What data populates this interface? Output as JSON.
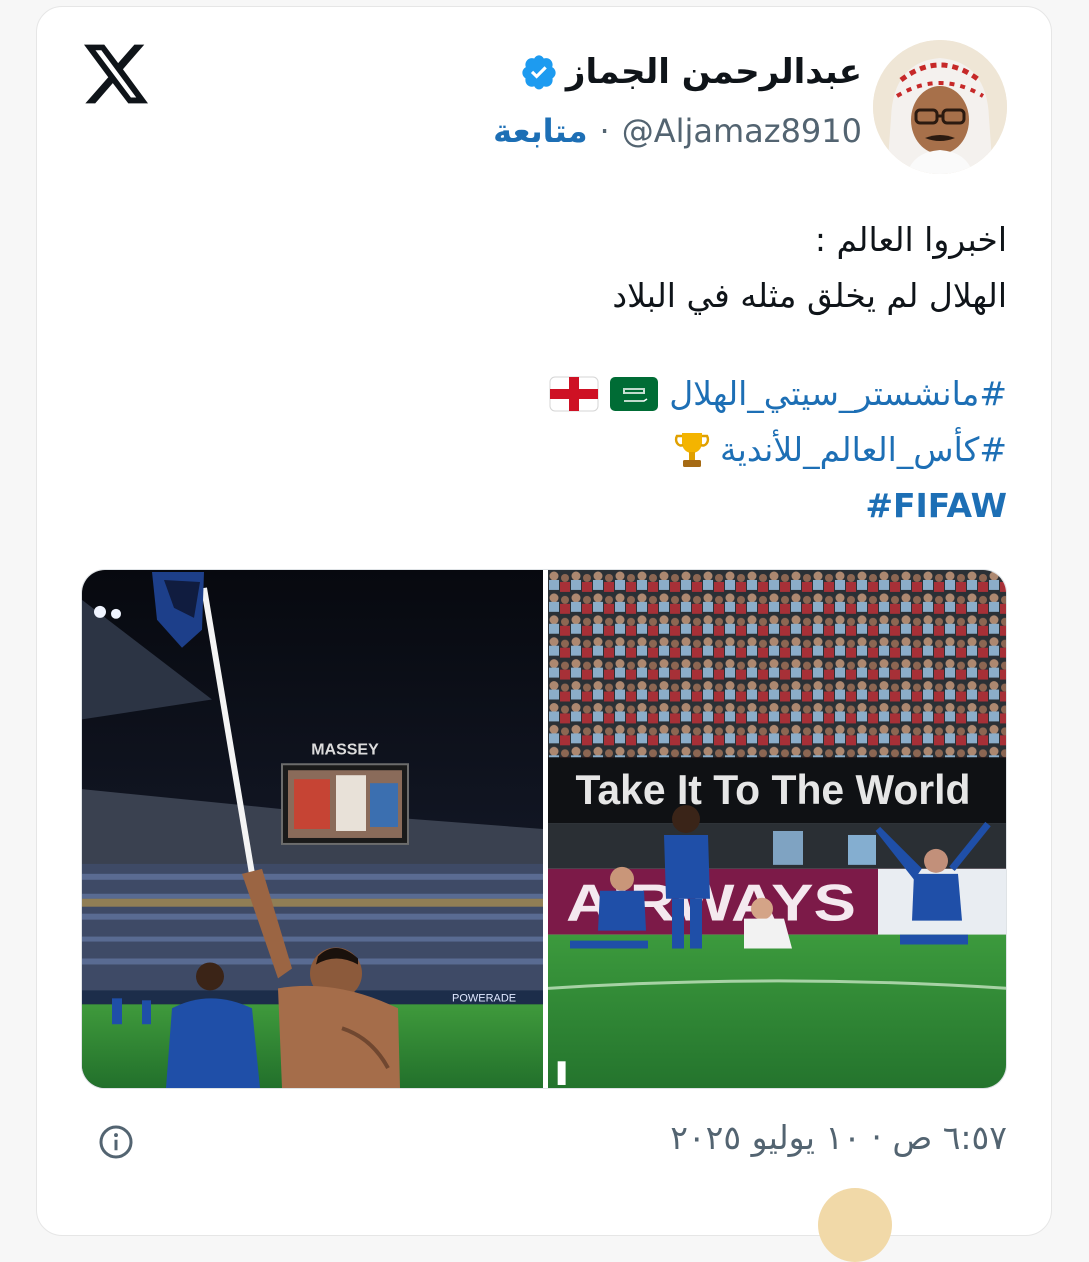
{
  "author": {
    "display_name": "عبدالرحمن الجماز",
    "handle": "@Aljamaz8910",
    "separator": "·",
    "follow_label": "متابعة",
    "verified": true
  },
  "tweet": {
    "line1": "اخبروا العالم :",
    "line2": "الهلال لم يخلق مثله في البلاد",
    "hashtags": [
      "#مانشستر_سيتي_الهلال",
      "#كأس_العالم_للأندية",
      "#FIFAW"
    ]
  },
  "media": {
    "left_photo": {
      "scoreboard_text": "MASSEY",
      "ad_board_text": "POWERADE"
    },
    "right_photo": {
      "banner_text": "Take It To The World",
      "ad_text": "AIRWAYS"
    }
  },
  "footer": {
    "timestamp": "٦:٥٧ ص · ١٠ يوليو ٢٠٢٥"
  },
  "colors": {
    "link": "#1d6fb5",
    "verified": "#1d9bf0",
    "text": "#0f1419",
    "muted": "#536471",
    "al_hilal_blue": "#1f4fa8"
  },
  "icons": [
    "x-logo-icon",
    "verified-badge-icon",
    "saudi-flag-icon",
    "england-flag-icon",
    "trophy-icon",
    "info-icon"
  ]
}
